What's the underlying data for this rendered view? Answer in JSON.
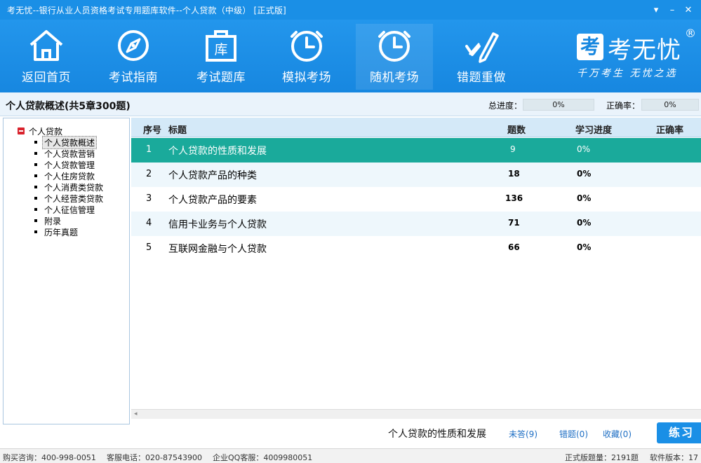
{
  "window": {
    "title": "考无忧--银行从业人员资格考试专用题库软件--个人贷款（中级）  [正式版]",
    "controls": {
      "menu": "▾",
      "minimize": "–",
      "close": "✕"
    }
  },
  "toolbar": {
    "items": [
      {
        "label": "返回首页",
        "icon": "home-icon"
      },
      {
        "label": "考试指南",
        "icon": "compass-icon"
      },
      {
        "label": "考试题库",
        "icon": "question-bank-icon"
      },
      {
        "label": "模拟考场",
        "icon": "clock-icon"
      },
      {
        "label": "随机考场",
        "icon": "random-clock-icon"
      },
      {
        "label": "错题重做",
        "icon": "check-pen-icon"
      }
    ],
    "active_index": 4
  },
  "brand": {
    "mark": "考",
    "name": "考无忧",
    "reg": "®",
    "slogan": "千万考生  无忧之选"
  },
  "header": {
    "title": "个人贷款概述(共5章300题)",
    "total_progress_label": "总进度：",
    "total_progress_value": "0%",
    "accuracy_label": "正确率：",
    "accuracy_value": "0%"
  },
  "tree": {
    "root": "个人贷款",
    "items": [
      "个人贷款概述",
      "个人贷款营销",
      "个人贷款管理",
      "个人住房贷款",
      "个人消费类贷款",
      "个人经营类贷款",
      "个人征信管理",
      "附录",
      "历年真题"
    ],
    "selected_index": 0
  },
  "table": {
    "headers": {
      "no": "序号",
      "title": "标题",
      "count": "题数",
      "progress": "学习进度",
      "accuracy": "正确率"
    },
    "rows": [
      {
        "no": "1",
        "title": "个人贷款的性质和发展",
        "count": "9",
        "progress": "0%",
        "accuracy": ""
      },
      {
        "no": "2",
        "title": "个人贷款产品的种类",
        "count": "18",
        "progress": "0%",
        "accuracy": ""
      },
      {
        "no": "3",
        "title": "个人贷款产品的要素",
        "count": "136",
        "progress": "0%",
        "accuracy": ""
      },
      {
        "no": "4",
        "title": "信用卡业务与个人贷款",
        "count": "71",
        "progress": "0%",
        "accuracy": ""
      },
      {
        "no": "5",
        "title": "互联网金融与个人贷款",
        "count": "66",
        "progress": "0%",
        "accuracy": ""
      }
    ],
    "selected_index": 0
  },
  "actions": {
    "current": "个人贷款的性质和发展",
    "unanswered": "未答(9)",
    "wrong": "错题(0)",
    "favorites": "收藏(0)",
    "practice": "练习"
  },
  "status": {
    "purchase": "购买咨询：400-998-0051",
    "service_phone": "客服电话：020-87543900",
    "qq": "企业QQ客服：4009980051",
    "question_count": "正式版题量：2191题",
    "version": "软件版本：17"
  }
}
